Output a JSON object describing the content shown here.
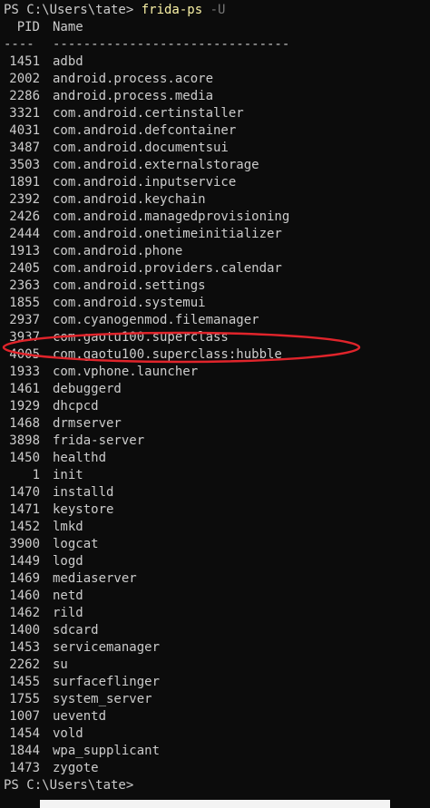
{
  "prompt1": {
    "prefix": "PS C:\\Users\\tate> ",
    "command": "frida-ps",
    "flag": " -U"
  },
  "header": {
    "pid": "PID",
    "name": "Name",
    "pid_rule": "----",
    "name_rule": "-------------------------------"
  },
  "processes": [
    {
      "pid": "1451",
      "name": "adbd"
    },
    {
      "pid": "2002",
      "name": "android.process.acore"
    },
    {
      "pid": "2286",
      "name": "android.process.media"
    },
    {
      "pid": "3321",
      "name": "com.android.certinstaller"
    },
    {
      "pid": "4031",
      "name": "com.android.defcontainer"
    },
    {
      "pid": "3487",
      "name": "com.android.documentsui"
    },
    {
      "pid": "3503",
      "name": "com.android.externalstorage"
    },
    {
      "pid": "1891",
      "name": "com.android.inputservice"
    },
    {
      "pid": "2392",
      "name": "com.android.keychain"
    },
    {
      "pid": "2426",
      "name": "com.android.managedprovisioning"
    },
    {
      "pid": "2444",
      "name": "com.android.onetimeinitializer"
    },
    {
      "pid": "1913",
      "name": "com.android.phone"
    },
    {
      "pid": "2405",
      "name": "com.android.providers.calendar"
    },
    {
      "pid": "2363",
      "name": "com.android.settings"
    },
    {
      "pid": "1855",
      "name": "com.android.systemui"
    },
    {
      "pid": "2937",
      "name": "com.cyanogenmod.filemanager"
    },
    {
      "pid": "3937",
      "name": "com.gaotu100.superclass"
    },
    {
      "pid": "4005",
      "name": "com.gaotu100.superclass:hubble"
    },
    {
      "pid": "1933",
      "name": "com.vphone.launcher"
    },
    {
      "pid": "1461",
      "name": "debuggerd"
    },
    {
      "pid": "1929",
      "name": "dhcpcd"
    },
    {
      "pid": "1468",
      "name": "drmserver"
    },
    {
      "pid": "3898",
      "name": "frida-server"
    },
    {
      "pid": "1450",
      "name": "healthd"
    },
    {
      "pid": "1",
      "name": "init"
    },
    {
      "pid": "1470",
      "name": "installd"
    },
    {
      "pid": "1471",
      "name": "keystore"
    },
    {
      "pid": "1452",
      "name": "lmkd"
    },
    {
      "pid": "3900",
      "name": "logcat"
    },
    {
      "pid": "1449",
      "name": "logd"
    },
    {
      "pid": "1469",
      "name": "mediaserver"
    },
    {
      "pid": "1460",
      "name": "netd"
    },
    {
      "pid": "1462",
      "name": "rild"
    },
    {
      "pid": "1400",
      "name": "sdcard"
    },
    {
      "pid": "1453",
      "name": "servicemanager"
    },
    {
      "pid": "2262",
      "name": "su"
    },
    {
      "pid": "1455",
      "name": "surfaceflinger"
    },
    {
      "pid": "1755",
      "name": "system_server"
    },
    {
      "pid": "1007",
      "name": "ueventd"
    },
    {
      "pid": "1454",
      "name": "vold"
    },
    {
      "pid": "1844",
      "name": "wpa_supplicant"
    },
    {
      "pid": "1473",
      "name": "zygote"
    }
  ],
  "prompt2": {
    "prefix": "PS C:\\Users\\tate>"
  },
  "colors": {
    "background": "#0c0c0c",
    "text": "#cccccc",
    "command": "#f9f1a5",
    "flag": "#767676",
    "annotation": "#e0242b"
  },
  "annotation": {
    "shape": "ellipse",
    "highlights": [
      "3937",
      "4005"
    ]
  }
}
